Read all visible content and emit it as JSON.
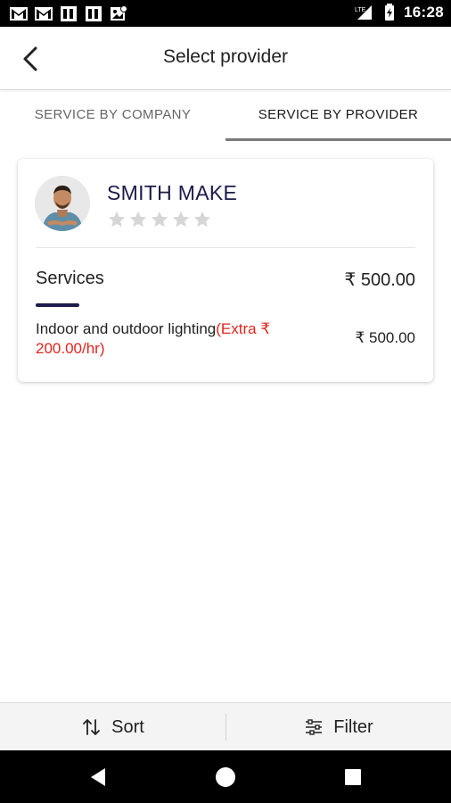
{
  "status_bar": {
    "time": "16:28",
    "left_icons": [
      "gmail-icon",
      "gmail-icon",
      "notification-icon",
      "notification-icon",
      "gallery-icon"
    ],
    "right_icons": [
      "signal-icon",
      "battery-icon"
    ]
  },
  "app_bar": {
    "back_icon": "back-arrow-icon",
    "title": "Select provider"
  },
  "tabs": [
    {
      "label": "SERVICE BY COMPANY",
      "active": false
    },
    {
      "label": "SERVICE BY PROVIDER",
      "active": true
    }
  ],
  "provider_card": {
    "name": "SMITH MAKE",
    "rating": 0,
    "max_rating": 5,
    "services_label": "Services",
    "services_total": "₹ 500.00",
    "services": [
      {
        "name": "Indoor and outdoor lighting",
        "extra": "(Extra ₹ 200.00/hr)",
        "price": "₹ 500.00"
      }
    ]
  },
  "bottom_bar": {
    "sort_label": "Sort",
    "sort_icon": "sort-arrows-icon",
    "filter_label": "Filter",
    "filter_icon": "filter-sliders-icon"
  },
  "nav_bar": {
    "icons": [
      "nav-back-icon",
      "nav-home-icon",
      "nav-recents-icon"
    ]
  },
  "colors": {
    "accent": "#1b1b4b",
    "extra_text": "#e3241b",
    "star_empty": "#d6d6d6"
  }
}
